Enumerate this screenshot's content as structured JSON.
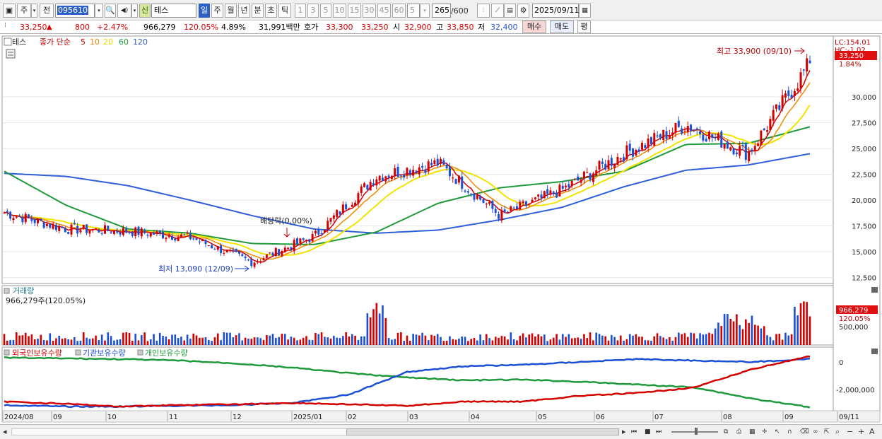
{
  "toolbar": {
    "btn_ju": "주",
    "btn_jeon": "전",
    "code": "095610",
    "sin": "신",
    "name": "테스",
    "periods": [
      "일",
      "주",
      "월",
      "년",
      "분",
      "초",
      "틱"
    ],
    "minutes": [
      "1",
      "3",
      "5",
      "10",
      "15",
      "30",
      "45",
      "60"
    ],
    "count_sel": "5",
    "count": "265",
    "count_total": "/600",
    "date": "2025/09/11"
  },
  "quote": {
    "price": "33,250",
    "arrow": "▲",
    "change": "800",
    "change_pct": "+2.47%",
    "volume": "966,279",
    "volume_pct": "120.05%",
    "turnover": "4.89%",
    "amount": "31,991백만",
    "hoga_label": "호가",
    "ask": "33,300",
    "bid": "33,250",
    "open_label": "시",
    "open": "32,900",
    "high_label": "고",
    "high": "33,850",
    "low_label": "저",
    "low": "32,400",
    "buy": "매수",
    "sell": "매도",
    "eval": "평"
  },
  "price_panel": {
    "legend_name": "테스",
    "legend_ma": "종가 단순",
    "ma_periods": [
      "5",
      "10",
      "20",
      "60",
      "120"
    ],
    "lc": "LC:154.01",
    "hc": "HC:-1.02",
    "last_price": "33,250",
    "last_pct": "1.84%",
    "high_note": "최고 33,900 (09/10)",
    "low_note": "최저 13,090 (12/09)",
    "dividend_note": "배당락(0.00%)",
    "y_ticks": [
      "30,000",
      "27,500",
      "25,000",
      "22,500",
      "20,000",
      "17,500",
      "15,000",
      "12,500"
    ]
  },
  "volume_panel": {
    "title": "거래량",
    "value": "966,279주(120.05%)",
    "last": "966,279",
    "last_pct": "120.05%",
    "tick": "500,000"
  },
  "holdings_panel": {
    "legends": [
      "외국인보유수량",
      "기관보유수량",
      "개인보유수량"
    ],
    "ticks": [
      "0",
      "-2,000,000"
    ]
  },
  "x_axis": [
    "2024/08",
    "09",
    "10",
    "11",
    "12",
    "2025/01",
    "02",
    "03",
    "04",
    "05",
    "06",
    "07",
    "08",
    "09",
    "09/11"
  ],
  "colors": {
    "up": "#d40000",
    "down": "#1a4fd6",
    "ma5": "#d40000",
    "ma10": "#f08a00",
    "ma20": "#f2e400",
    "ma60": "#1f9a3a",
    "ma120": "#2e5fd8"
  },
  "chart_data": {
    "type": "line",
    "title": "",
    "xlabel": "",
    "ylabel": "",
    "ylim": [
      12000,
      35000
    ],
    "x": [
      "2024/08",
      "09",
      "10",
      "11",
      "12",
      "2025/01",
      "02",
      "03",
      "04",
      "05",
      "06",
      "07",
      "08",
      "09"
    ],
    "series": [
      {
        "name": "종가",
        "values": [
          18800,
          17200,
          17000,
          16400,
          14000,
          16500,
          22300,
          23600,
          18500,
          21000,
          24500,
          27300,
          24500,
          33250
        ]
      },
      {
        "name": "5",
        "values": [
          18900,
          17300,
          17100,
          16500,
          14200,
          16200,
          22000,
          23400,
          18800,
          21100,
          24400,
          27200,
          24800,
          31000
        ]
      },
      {
        "name": "60",
        "values": [
          22800,
          19500,
          17200,
          16800,
          15800,
          15700,
          16900,
          19700,
          21200,
          21800,
          22800,
          25400,
          25500,
          27100
        ]
      },
      {
        "name": "120",
        "values": [
          22600,
          22300,
          21400,
          20000,
          18500,
          17200,
          16800,
          17100,
          18100,
          19300,
          21300,
          22900,
          23400,
          24500
        ]
      }
    ]
  }
}
